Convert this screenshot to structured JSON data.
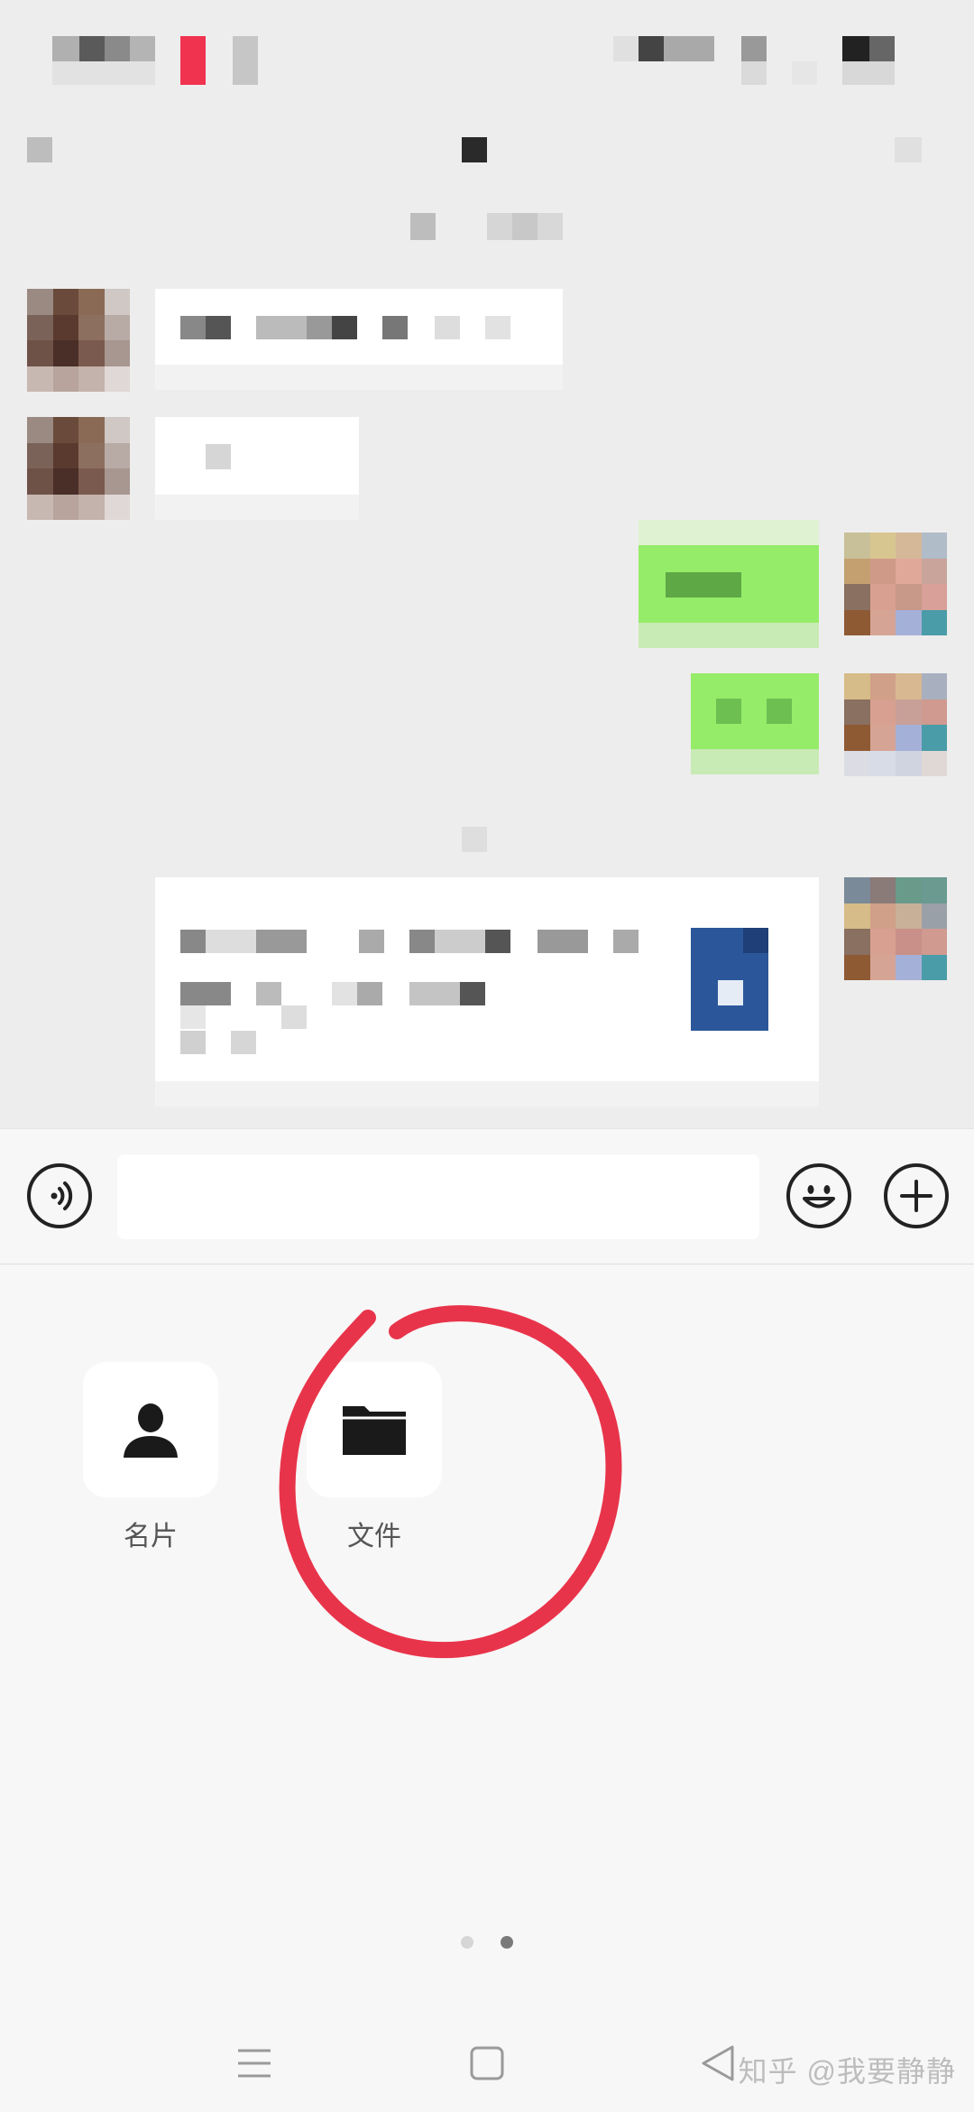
{
  "tools": [
    {
      "label": "名片",
      "icon": "contact-card-icon"
    },
    {
      "label": "文件",
      "icon": "folder-icon"
    }
  ],
  "pager": {
    "page_count": 2,
    "current_page": 2
  },
  "watermark": "知乎 @我要静静",
  "colors": {
    "chat_background": "#ededed",
    "sent_bubble": "#95ec69",
    "received_bubble": "#ffffff",
    "file_icon_blue": "#2b579a",
    "annotation_red": "#e8344a"
  },
  "icons": {
    "voice": "voice-input-icon",
    "emoji": "emoji-icon",
    "more": "plus-icon",
    "nav_menu": "menu-icon",
    "nav_home": "home-square-icon",
    "nav_back": "back-triangle-icon"
  }
}
